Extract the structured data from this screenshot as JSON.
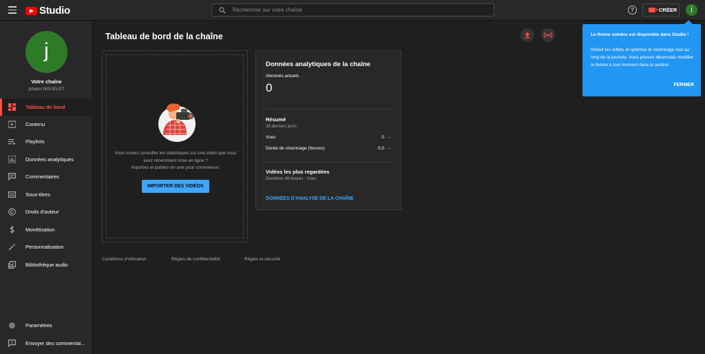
{
  "app": {
    "logo_text": "Studio"
  },
  "search": {
    "placeholder": "Rechercher sur votre chaîne"
  },
  "header": {
    "help_glyph": "?",
    "create_label": "CRÉER",
    "avatar_letter": "j"
  },
  "channel": {
    "avatar_letter": "j",
    "title": "Votre chaîne",
    "owner": "johann NGUELET"
  },
  "sidebar": {
    "items": [
      {
        "label": "Tableau de bord",
        "icon": "dashboard-icon",
        "active": true
      },
      {
        "label": "Contenu",
        "icon": "content-icon"
      },
      {
        "label": "Playlists",
        "icon": "playlists-icon"
      },
      {
        "label": "Données analytiques",
        "icon": "analytics-icon"
      },
      {
        "label": "Commentaires",
        "icon": "comments-icon"
      },
      {
        "label": "Sous-titres",
        "icon": "subtitles-icon"
      },
      {
        "label": "Droits d'auteur",
        "icon": "copyright-icon"
      },
      {
        "label": "Monétisation",
        "icon": "dollar-icon"
      },
      {
        "label": "Personnalisation",
        "icon": "magic-wand-icon"
      },
      {
        "label": "Bibliothèque audio",
        "icon": "audio-library-icon"
      }
    ],
    "bottom": [
      {
        "label": "Paramètres",
        "icon": "gear-icon"
      },
      {
        "label": "Envoyer des commentai...",
        "icon": "feedback-icon"
      }
    ]
  },
  "main": {
    "title": "Tableau de bord de la chaîne",
    "upload_card": {
      "text_line1": "Vous voulez consulter les statistiques sur une vidéo que vous",
      "text_line2": "avez récemment mise en ligne ?",
      "text_line3": "Importez et publiez-en une pour commencer.",
      "button": "IMPORTER DES VIDÉOS"
    },
    "analytics": {
      "title": "Données analytiques de la chaîne",
      "subscribers_label": "Abonnés actuels",
      "subscribers_value": "0",
      "summary_title": "Résumé",
      "summary_period": "28 derniers jours",
      "rows": [
        {
          "label": "Vues",
          "value": "0",
          "delta": "—"
        },
        {
          "label": "Durée de visionnage (heures)",
          "value": "0,0",
          "delta": "—"
        }
      ],
      "top_videos_title": "Vidéos les plus regardées",
      "top_videos_sub": "Dernières 48 heures · Vues",
      "link": "DONNÉES D'ANALYSE DE LA CHAÎNE"
    },
    "footer": [
      "Conditions d'utilisation",
      "Règles de confidentialité",
      "Règles et sécurité"
    ]
  },
  "tooltip": {
    "title": "Le thème sombre est disponible dans Studio !",
    "body": "Réduit les reflets et optimise le visionnage tout au long de la journée. Vous pouvez désormais modifier le thème à tout moment dans la section",
    "close": "FERMER"
  },
  "colors": {
    "accent": "#3ea6ff",
    "active_red": "#ff4e45",
    "tooltip_bg": "#2196f3",
    "avatar_green": "#2d7b27",
    "brand_red": "#ff0000"
  }
}
